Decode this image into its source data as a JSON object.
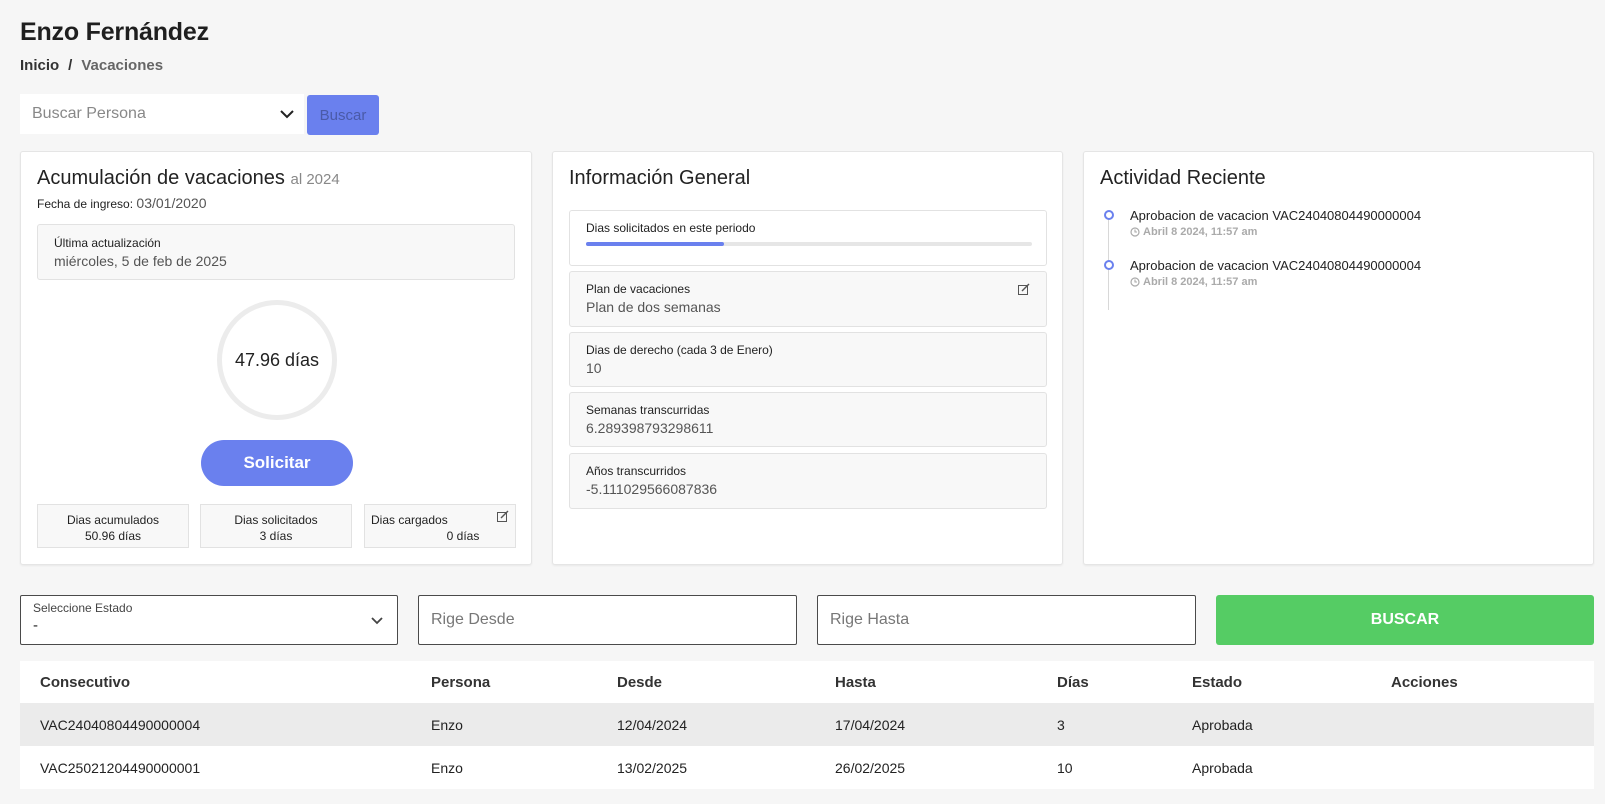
{
  "header": {
    "title": "Enzo Fernández",
    "breadcrumb": {
      "home": "Inicio",
      "separator": "/",
      "current": "Vacaciones"
    }
  },
  "person_search": {
    "placeholder": "Buscar Persona",
    "button_label": "Buscar"
  },
  "accumulation": {
    "title": "Acumulación de vacaciones",
    "title_suffix": "al 2024",
    "entry_date_label": "Fecha de ingreso:",
    "entry_date": "03/01/2020",
    "last_update_label": "Última actualización",
    "last_update_value": "miércoles, 5 de feb de 2025",
    "total_days": "47.96 días",
    "request_button": "Solicitar",
    "stats": [
      {
        "label": "Dias acumulados",
        "value": "50.96 días"
      },
      {
        "label": "Dias solicitados",
        "value": "3 días"
      },
      {
        "label": "Dias cargados",
        "value": "0 días"
      }
    ]
  },
  "general_info": {
    "title": "Información General",
    "requested_period_label": "Dias solicitados en este periodo",
    "requested_period_progress": 0.31,
    "plan_label": "Plan de vacaciones",
    "plan_value": "Plan de dos semanas",
    "entitled_label": "Dias de derecho (cada 3 de Enero)",
    "entitled_value": "10",
    "weeks_label": "Semanas transcurridas",
    "weeks_value": "6.289398793298611",
    "years_label": "Años transcurridos",
    "years_value": "-5.111029566087836"
  },
  "recent_activity": {
    "title": "Actividad Reciente",
    "items": [
      {
        "text": "Aprobacion de vacacion VAC24040804490000004",
        "time": "Abril 8 2024, 11:57 am"
      },
      {
        "text": "Aprobacion de vacacion VAC24040804490000004",
        "time": "Abril 8 2024, 11:57 am"
      }
    ]
  },
  "filters": {
    "status_label": "Seleccione Estado",
    "status_value": "-",
    "from_placeholder": "Rige Desde",
    "to_placeholder": "Rige Hasta",
    "search_button": "BUSCAR"
  },
  "table": {
    "headers": [
      "Consecutivo",
      "Persona",
      "Desde",
      "Hasta",
      "Días",
      "Estado",
      "Acciones"
    ],
    "rows": [
      [
        "VAC24040804490000004",
        "Enzo",
        "12/04/2024",
        "17/04/2024",
        "3",
        "Aprobada",
        ""
      ],
      [
        "VAC25021204490000001",
        "Enzo",
        "13/02/2025",
        "26/02/2025",
        "10",
        "Aprobada",
        ""
      ]
    ]
  },
  "colors": {
    "accent": "#6a80ee",
    "success": "#55cc64",
    "background": "#f6f6f6"
  }
}
